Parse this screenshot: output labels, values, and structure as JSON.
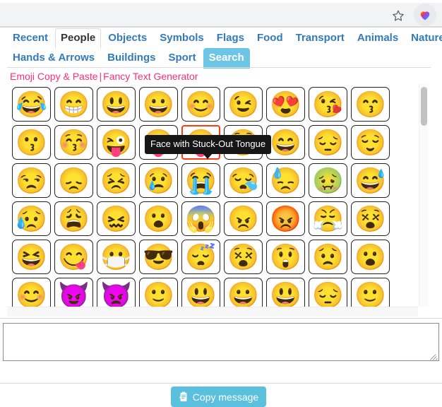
{
  "browser": {
    "bookmark_icon": "star-icon",
    "extension_icon": "rainbow-heart-icon"
  },
  "tabs": {
    "row1": [
      {
        "label": "Recent",
        "state": "normal"
      },
      {
        "label": "People",
        "state": "active"
      },
      {
        "label": "Objects",
        "state": "normal"
      },
      {
        "label": "Symbols",
        "state": "normal"
      },
      {
        "label": "Flags",
        "state": "normal"
      },
      {
        "label": "Food",
        "state": "normal"
      },
      {
        "label": "Transport",
        "state": "normal"
      },
      {
        "label": "Animals",
        "state": "normal"
      },
      {
        "label": "Nature",
        "state": "normal"
      }
    ],
    "row2": [
      {
        "label": "Hands & Arrows",
        "state": "normal"
      },
      {
        "label": "Buildings",
        "state": "normal"
      },
      {
        "label": "Sport",
        "state": "normal"
      },
      {
        "label": "Search",
        "state": "hover"
      }
    ]
  },
  "promo": {
    "link1": "Emoji Copy & Paste",
    "separator": "|",
    "link2": "Fancy Text Generator"
  },
  "tooltip": {
    "text": "Face with Stuck-Out Tongue"
  },
  "emoji_grid": {
    "selected_index": 13,
    "rows": [
      [
        "😂",
        "😁",
        "😃",
        "😀",
        "😊",
        "😉",
        "😍",
        "😘",
        "😙"
      ],
      [
        "😗",
        "😚",
        "😜",
        "😝",
        "😛",
        "😳",
        "😄",
        "😔",
        "😌"
      ],
      [
        "😒",
        "😞",
        "😣",
        "😢",
        "😭",
        "😪",
        "😓",
        "🤢",
        "😅"
      ],
      [
        "😥",
        "😩",
        "😖",
        "😮",
        "😱",
        "😠",
        "😡",
        "😤",
        "😵"
      ],
      [
        "😆",
        "😋",
        "😷",
        "😎",
        "😴",
        "😵",
        "😲",
        "😟",
        "😮"
      ],
      [
        "😊",
        "😈",
        "👿",
        "🙂",
        "😃",
        "😀",
        "😃",
        "😔",
        "🙂"
      ]
    ]
  },
  "message": {
    "value": "",
    "placeholder": ""
  },
  "copy_button": {
    "label": "Copy message",
    "icon": "clipboard-icon",
    "color": "#5bc0de"
  },
  "colors": {
    "tab_link": "#337ab7",
    "tab_hover_bg": "#6cc5e4",
    "promo_link": "#ff2d78",
    "selected_border": "#ff3b10",
    "tooltip_bg": "#161616"
  }
}
